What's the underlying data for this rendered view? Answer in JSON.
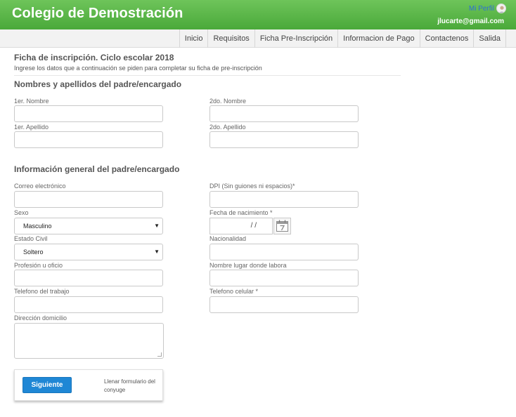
{
  "header": {
    "brand": "Colegio de Demostración",
    "profile_label": "Mi Perfil",
    "user_email": "jlucarte@gmail.com"
  },
  "nav": {
    "items": [
      "Inicio",
      "Requisitos",
      "Ficha Pre-Inscripción",
      "Informacion de Pago",
      "Contactenos",
      "Salida"
    ]
  },
  "form": {
    "title": "Ficha de inscripción. Ciclo escolar 2018",
    "subtitle": "Ingrese los datos que a continuación se piden para completar su ficha de pre-inscripción",
    "section_names": {
      "title": "Nombres y apellidos del padre/encargado",
      "first_name_label": "1er. Nombre",
      "second_name_label": "2do. Nombre",
      "first_surname_label": "1er. Apellido",
      "second_surname_label": "2do. Apellido"
    },
    "section_general": {
      "title": "Información general del padre/encargado",
      "email_label": "Correo electrónico",
      "dpi_label": "DPI (Sin guiones ni espacios)*",
      "sex_label": "Sexo",
      "sex_value": "Masculino",
      "birthdate_label": "Fecha de nacimiento *",
      "birthdate_placeholder": "/  /",
      "civil_status_label": "Estado Civil",
      "civil_status_value": "Soltero",
      "nationality_label": "Nacionalidad",
      "profession_label": "Profesión u oficio",
      "workplace_label": "Nombre lugar donde labora",
      "work_phone_label": "Telefono del trabajo",
      "mobile_phone_label": "Telefono celular *",
      "address_label": "Dirección domicilio"
    },
    "actions": {
      "next_label": "Siguiente",
      "spouse_link": "Llenar formulario del conyuge"
    }
  },
  "colors": {
    "header_green": "#4aa93a",
    "primary_button": "#1f87d5"
  }
}
